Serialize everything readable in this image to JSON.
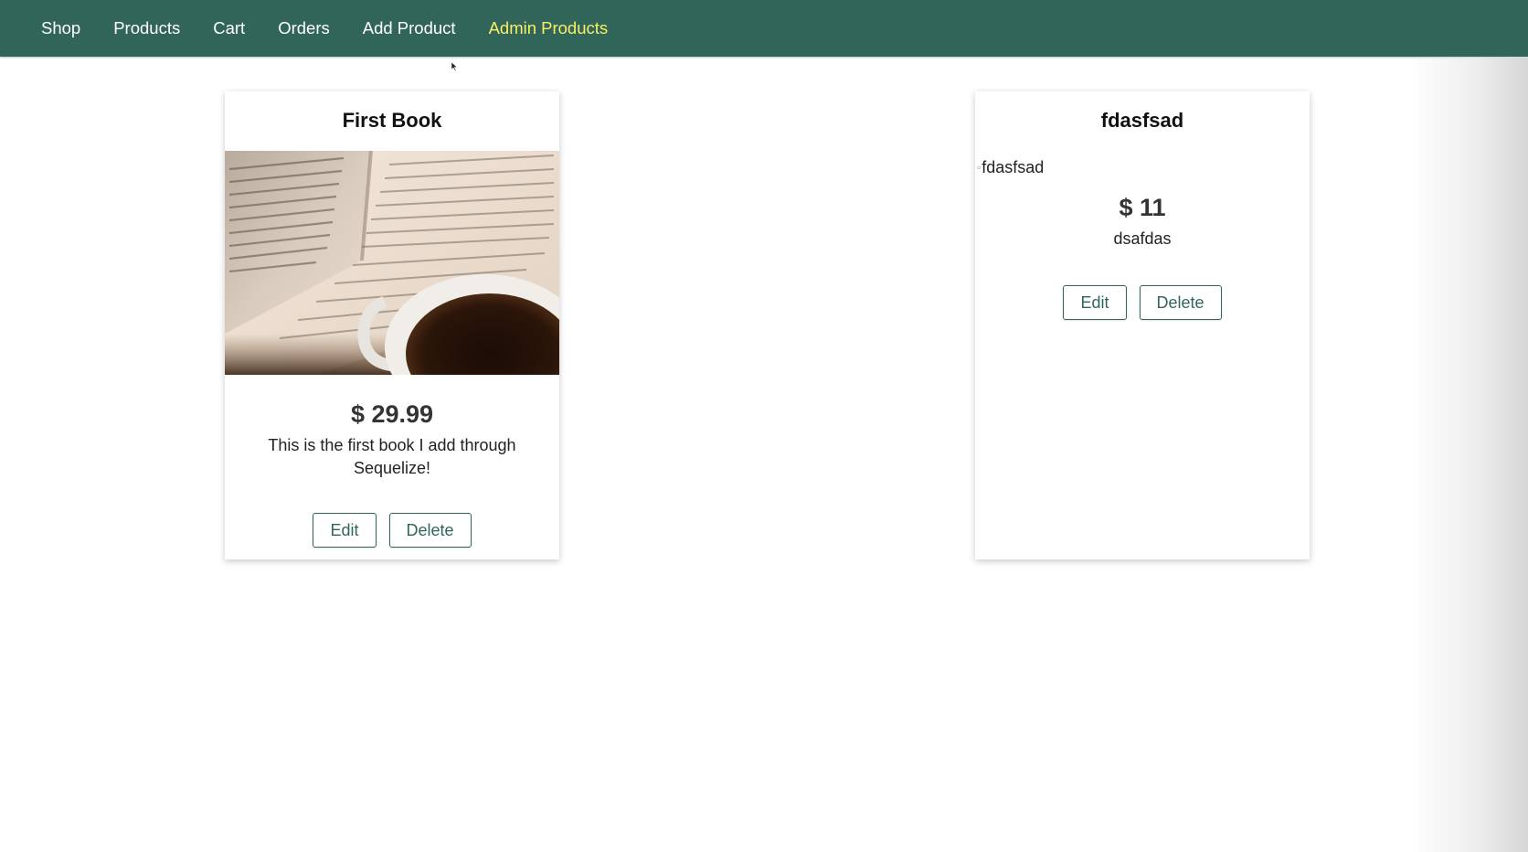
{
  "nav": {
    "items": [
      {
        "label": "Shop",
        "active": false
      },
      {
        "label": "Products",
        "active": false
      },
      {
        "label": "Cart",
        "active": false
      },
      {
        "label": "Orders",
        "active": false
      },
      {
        "label": "Add Product",
        "active": false
      },
      {
        "label": "Admin Products",
        "active": true
      }
    ]
  },
  "products": [
    {
      "title": "First Book",
      "image_alt": "First Book",
      "image_icon": "open-book-with-coffee-cup-photo",
      "price": "$ 29.99",
      "description": "This is the first book I add through Sequelize!",
      "edit_label": "Edit",
      "delete_label": "Delete"
    },
    {
      "title": "fdasfsad",
      "image_alt": "fdasfsad",
      "image_icon": "broken-image-icon",
      "price": "$ 11",
      "description": "dsafdas",
      "edit_label": "Edit",
      "delete_label": "Delete"
    }
  ],
  "colors": {
    "header_bg": "#32655a",
    "nav_active": "#f7ef65",
    "nav_text": "#ffffff",
    "button_border": "#32655a"
  }
}
